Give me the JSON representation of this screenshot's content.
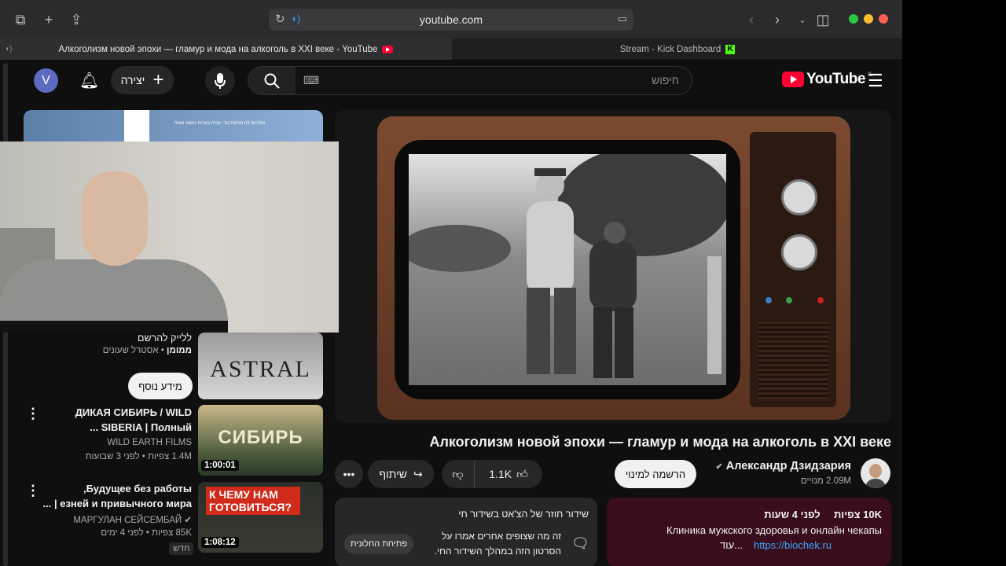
{
  "browser": {
    "address": "youtube.com",
    "tabs": [
      {
        "title": "Алкоголизм новой эпохи — гламур и мода на алкоголь в XXI веке - YouTube"
      },
      {
        "title": "Stream - Kick Dashboard"
      }
    ]
  },
  "header": {
    "avatar_letter": "V",
    "create_label": "יצירה",
    "search_placeholder": "חיפוש",
    "logo_text": "YouTube",
    "logo_country": "IL"
  },
  "sidebar_ad": {
    "text": "אלוהים לנו מחפת נוד. עזרה בצרות נמצא מאוד."
  },
  "promo": {
    "line1": "ללייק להרשם",
    "sponsored_label": "ממומן",
    "channel": "אסטרל שעונים",
    "more_info": "מידע נוסף",
    "thumb_text": "ASTRAL"
  },
  "recommendations": [
    {
      "title_line1": "ДИКАЯ СИБИРЬ / WILD",
      "title_line2": "SIBERIA | Полный ...",
      "channel": "WILD EARTH FILMS",
      "meta": "1.4M צפיות • לפני 3 שבועות",
      "duration": "1:00:01",
      "thumb_text": "СИБИРЬ"
    },
    {
      "title_line1": "Будущее без работы,",
      "title_line2": "езней и привычного мира | ...",
      "channel": "МАРГУЛАН СЕЙСЕМБАЙ",
      "meta": "85K צפיות • לפני 4 ימים",
      "badge": "חדש",
      "duration": "1:08:12",
      "thumb_text": "К ЧЕМУ НАМ ГОТОВИТЬСЯ?"
    }
  ],
  "video": {
    "title": "Алкоголизм новой эпохи — гламур и мода на алкоголь в XXI веке",
    "channel_name": "Александр Дзидзария",
    "subscribers": "2.09M מנויים",
    "subscribe_label": "הרשמה למינוי",
    "likes": "1.1K",
    "share_label": "שיתוף"
  },
  "live_chat": {
    "title": "שידור חוזר של הצ'אט בשידור חי",
    "body_line1": "זה מה שצופים אחרים אמרו על",
    "body_line2": "הסרטון הזה במהלך השידור החי.",
    "open_label": "פתיחת החלונית"
  },
  "description": {
    "views": "10K צפיות",
    "age": "לפני 4 שעות",
    "line1": "Клиника мужского здоровья и онлайн чекапы",
    "link": "https://biochek.ru",
    "more": "...עוד"
  },
  "colors": {
    "page_bg": "#0f0f0f",
    "youtube_red": "#ff0033",
    "pill_bg": "#272727",
    "desc_bg": "#3a0d1c",
    "kick_green": "#53fc18"
  }
}
